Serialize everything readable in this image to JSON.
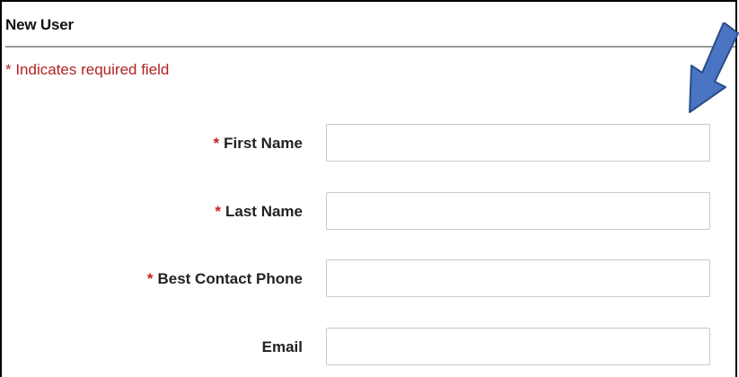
{
  "panel": {
    "title": "New User",
    "required_note": "* Indicates required field"
  },
  "form": {
    "fields": [
      {
        "required_marker": "*",
        "label": "First Name",
        "value": "",
        "placeholder": ""
      },
      {
        "required_marker": "*",
        "label": "Last Name",
        "value": "",
        "placeholder": ""
      },
      {
        "required_marker": "*",
        "label": "Best Contact Phone",
        "value": "",
        "placeholder": ""
      },
      {
        "required_marker": "",
        "label": "Email",
        "value": "",
        "placeholder": ""
      }
    ]
  },
  "annotation": {
    "icon": "arrow-down-left-icon",
    "fill_color": "#4a74c4",
    "stroke_color": "#2c4d86"
  },
  "colors": {
    "required_text": "#b22222",
    "required_star": "#cc1f1f",
    "rule": "#9a9a9a",
    "input_border": "#c8c8c8"
  }
}
